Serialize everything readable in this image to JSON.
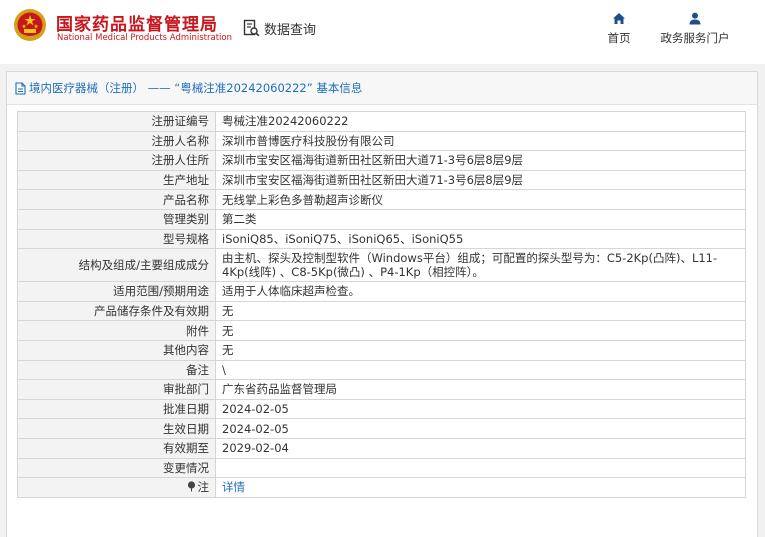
{
  "header": {
    "brand_cn": "国家药品监督管理局",
    "brand_en": "National Medical Products Administration",
    "query_label": "数据查询",
    "nav": [
      {
        "label": "首页",
        "icon": "home-icon"
      },
      {
        "label": "政务服务门户",
        "icon": "user-icon"
      }
    ],
    "brand_color": "#c8161d",
    "link_color": "#1e6fba"
  },
  "panel": {
    "title": "境内医疗器械（注册） —— “粤械注准20242060222” 基本信息"
  },
  "rows": [
    {
      "label": "注册证编号",
      "value": "粤械注准20242060222"
    },
    {
      "label": "注册人名称",
      "value": "深圳市普博医疗科技股份有限公司"
    },
    {
      "label": "注册人住所",
      "value": "深圳市宝安区福海街道新田社区新田大道71-3号6层8层9层"
    },
    {
      "label": "生产地址",
      "value": "深圳市宝安区福海街道新田社区新田大道71-3号6层8层9层"
    },
    {
      "label": "产品名称",
      "value": "无线掌上彩色多普勒超声诊断仪"
    },
    {
      "label": "管理类别",
      "value": "第二类"
    },
    {
      "label": "型号规格",
      "value": "iSoniQ85、iSoniQ75、iSoniQ65、iSoniQ55"
    },
    {
      "label": "结构及组成/主要组成成分",
      "value": "由主机、探头及控制型软件（Windows平台）组成；可配置的探头型号为：C5-2Kp(凸阵)、L11-4Kp(线阵) 、C8-5Kp(微凸) 、P4-1Kp（相控阵）。"
    },
    {
      "label": "适用范围/预期用途",
      "value": "适用于人体临床超声检查。"
    },
    {
      "label": "产品储存条件及有效期",
      "value": "无"
    },
    {
      "label": "附件",
      "value": "无"
    },
    {
      "label": "其他内容",
      "value": "无"
    },
    {
      "label": "备注",
      "value": "\\"
    },
    {
      "label": "审批部门",
      "value": "广东省药品监督管理局"
    },
    {
      "label": "批准日期",
      "value": "2024-02-05"
    },
    {
      "label": "生效日期",
      "value": "2024-02-05"
    },
    {
      "label": "有效期至",
      "value": "2029-02-04"
    },
    {
      "label": "变更情况",
      "value": ""
    }
  ],
  "note": {
    "label": "注",
    "link": "详情",
    "icon": "info-pin-icon"
  }
}
